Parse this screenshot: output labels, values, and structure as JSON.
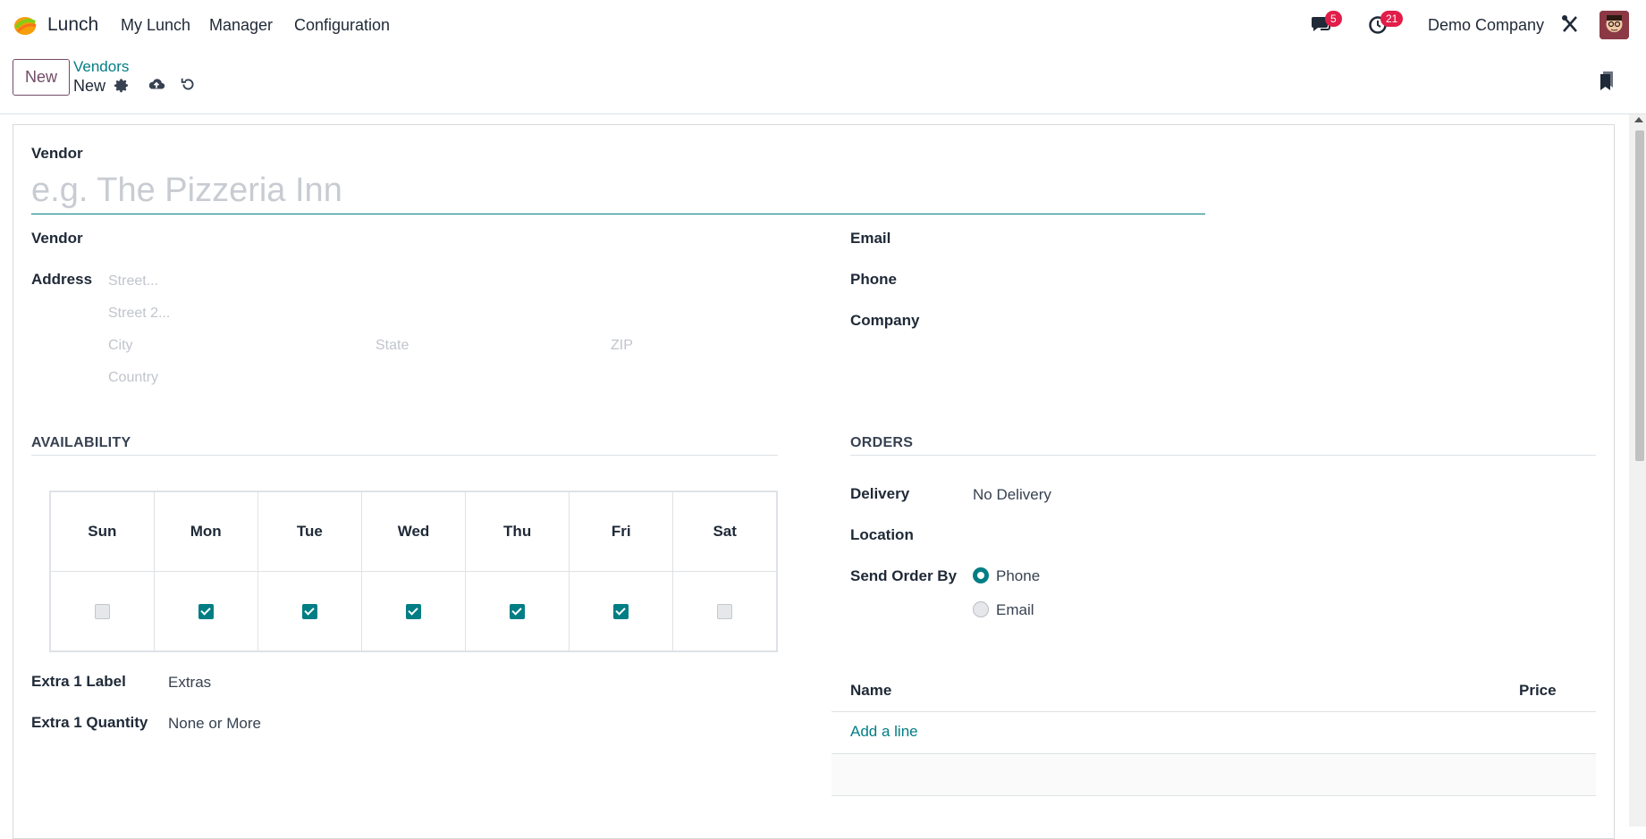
{
  "navbar": {
    "app_name": "Lunch",
    "menu": [
      "My Lunch",
      "Manager",
      "Configuration"
    ],
    "messages_count": "5",
    "activities_count": "21",
    "company": "Demo Company"
  },
  "control": {
    "new_button": "New",
    "breadcrumb_parent": "Vendors",
    "breadcrumb_current": "New"
  },
  "form": {
    "name_label": "Vendor",
    "name_placeholder": "e.g. The Pizzeria Inn",
    "vendor_label": "Vendor",
    "address_label": "Address",
    "street_placeholder": "Street...",
    "street2_placeholder": "Street 2...",
    "city_placeholder": "City",
    "state_placeholder": "State",
    "zip_placeholder": "ZIP",
    "country_placeholder": "Country",
    "email_label": "Email",
    "phone_label": "Phone",
    "company_label": "Company",
    "availability_title": "AVAILABILITY",
    "days": [
      {
        "name": "Sun",
        "checked": false
      },
      {
        "name": "Mon",
        "checked": true
      },
      {
        "name": "Tue",
        "checked": true
      },
      {
        "name": "Wed",
        "checked": true
      },
      {
        "name": "Thu",
        "checked": true
      },
      {
        "name": "Fri",
        "checked": true
      },
      {
        "name": "Sat",
        "checked": false
      }
    ],
    "extra1_label_label": "Extra 1 Label",
    "extra1_label_value": "Extras",
    "extra1_qty_label": "Extra 1 Quantity",
    "extra1_qty_value": "None or More",
    "orders_title": "ORDERS",
    "delivery_label": "Delivery",
    "delivery_value": "No Delivery",
    "location_label": "Location",
    "send_order_label": "Send Order By",
    "send_options": [
      {
        "label": "Phone",
        "selected": true
      },
      {
        "label": "Email",
        "selected": false
      }
    ],
    "list_col_name": "Name",
    "list_col_price": "Price",
    "add_line": "Add a line"
  },
  "colors": {
    "primary": "#714b67",
    "accent": "#017e84",
    "badge": "#e11d48"
  }
}
